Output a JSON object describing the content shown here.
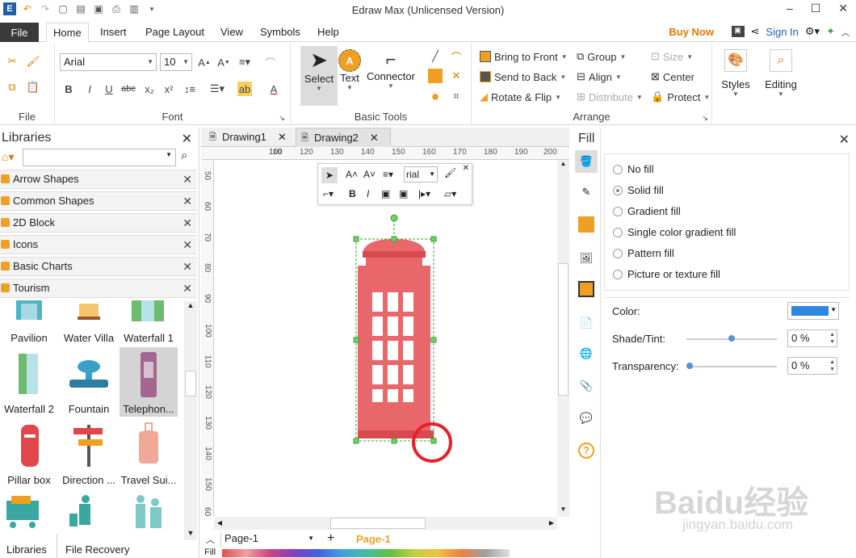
{
  "app": {
    "title": "Edraw Max (Unlicensed Version)"
  },
  "ribbon_tabs": {
    "file": "File",
    "items": [
      "Home",
      "Insert",
      "Page Layout",
      "View",
      "Symbols",
      "Help"
    ],
    "buy_now": "Buy Now",
    "sign_in": "Sign In"
  },
  "ribbon": {
    "file_group": "File",
    "font": {
      "name": "Arial",
      "size": "10",
      "group": "Font"
    },
    "basic_tools": {
      "select": "Select",
      "text": "Text",
      "connector": "Connector",
      "group": "Basic Tools"
    },
    "arrange": {
      "bring_to_front": "Bring to Front",
      "send_to_back": "Send to Back",
      "rotate_flip": "Rotate & Flip",
      "group_label": "Group",
      "align": "Align",
      "distribute": "Distribute",
      "size": "Size",
      "center": "Center",
      "protect": "Protect",
      "group": "Arrange"
    },
    "styles": "Styles",
    "editing": "Editing"
  },
  "libraries": {
    "title": "Libraries",
    "categories": [
      "Arrow Shapes",
      "Common Shapes",
      "2D Block",
      "Icons",
      "Basic Charts",
      "Tourism"
    ],
    "shapes": [
      "Pavilion",
      "Water Villa",
      "Waterfall 1",
      "Waterfall 2",
      "Fountain",
      "Telephon...",
      "Pillar box",
      "Direction ...",
      "Travel Sui..."
    ],
    "bottom": [
      "Libraries",
      "File Recovery"
    ]
  },
  "documents": {
    "tabs": [
      "Drawing1",
      "Drawing2"
    ]
  },
  "ruler": {
    "h": [
      "100",
      "110",
      "120",
      "130",
      "140",
      "150",
      "160",
      "170",
      "180",
      "190",
      "200"
    ],
    "v": [
      "50",
      "60",
      "70",
      "80",
      "90",
      "100",
      "110",
      "120",
      "130",
      "140",
      "150",
      "60"
    ]
  },
  "mini_toolbar": {
    "font": "rial"
  },
  "pagebar": {
    "page_select": "Page-1",
    "current_page": "Page-1",
    "fill_label": "Fill"
  },
  "fill_panel": {
    "title": "Fill",
    "options": [
      "No fill",
      "Solid fill",
      "Gradient fill",
      "Single color gradient fill",
      "Pattern fill",
      "Picture or texture fill"
    ],
    "selected": "Solid fill",
    "color_label": "Color:",
    "color_value": "#2e86de",
    "shade_label": "Shade/Tint:",
    "shade_value": "0 %",
    "transparency_label": "Transparency:",
    "transparency_value": "0 %"
  },
  "colors": {
    "phonebox": "#e8676b",
    "phonebox_dark": "#d94a4f",
    "selection": "#2ea32e",
    "highlight": "#e8202a"
  },
  "watermark": {
    "main": "Baidu经验",
    "sub": "jingyan.baidu.com"
  }
}
